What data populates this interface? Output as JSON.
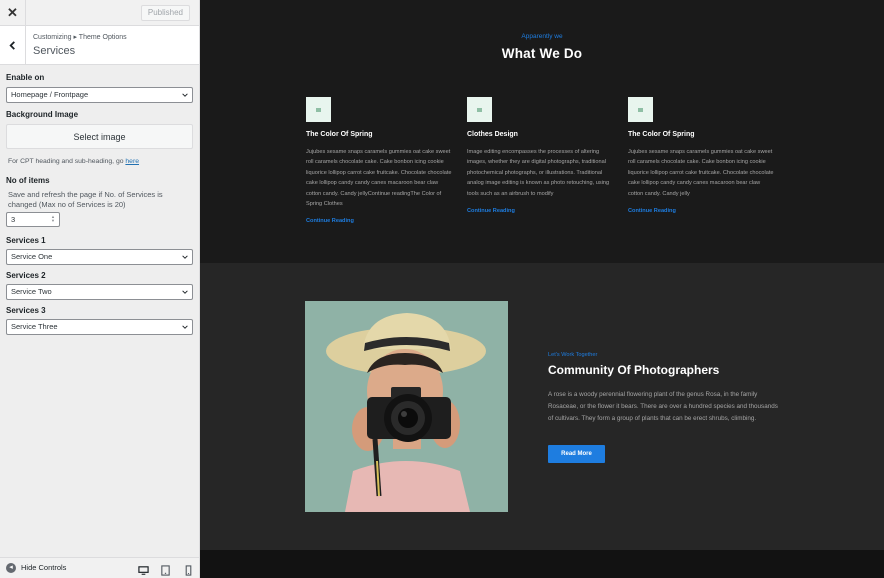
{
  "sidebar": {
    "close_icon": "close-icon",
    "publish_label": "Published",
    "breadcrumb": "Customizing ▸ Theme Options",
    "section_title": "Services",
    "enable_on": {
      "label": "Enable on",
      "value": "Homepage / Frontpage"
    },
    "background_image": {
      "label": "Background Image",
      "button": "Select image"
    },
    "cpt_note": {
      "text": "For CPT heading and sub-heading, go",
      "link": "here"
    },
    "no_of_items": {
      "label": "No of items",
      "description": "Save and refresh the page if No. of Services is changed (Max no of Services is 20)",
      "value": "3"
    },
    "services": [
      {
        "label": "Services 1",
        "value": "Service One"
      },
      {
        "label": "Services 2",
        "value": "Service Two"
      },
      {
        "label": "Services 3",
        "value": "Service Three"
      }
    ],
    "footer": {
      "hide_label": "Hide Controls",
      "devices": [
        "desktop-icon",
        "tablet-icon",
        "mobile-icon"
      ]
    }
  },
  "preview": {
    "services_section": {
      "subtitle": "Apparently we",
      "title": "What We Do",
      "cards": [
        {
          "title": "The Color Of Spring",
          "text": "Jujubes sesame snaps caramels gummies oat cake sweet roll caramels chocolate cake. Cake bonbon icing cookie liquorice lollipop carrot cake fruitcake. Chocolate chocolate cake lollipop candy candy canes macaroon bear claw cotton candy. Candy jellyContinue readingThe Color of Spring Clothes",
          "link": "Continue Reading"
        },
        {
          "title": "Clothes Design",
          "text": "Image editing encompasses the processes of altering images, whether they are digital photographs, traditional photochemical photographs, or illustrations. Traditional analog image editing is known as photo retouching, using tools such as an airbrush to modify",
          "link": "Continue Reading"
        },
        {
          "title": "The Color Of Spring",
          "text": "Jujubes sesame snaps caramels gummies oat cake sweet roll caramels chocolate cake. Cake bonbon icing cookie liquorice lollipop carrot cake fruitcake. Chocolate chocolate cake lollipop candy candy canes macaroon bear claw cotton candy. Candy jelly",
          "link": "Continue Reading"
        }
      ]
    },
    "community_section": {
      "eyebrow": "Let's Work Together",
      "title": "Community Of Photographers",
      "text": "A rose is a woody perennial flowering plant of the genus Rosa, in the family Rosaceae, or the flower it bears. There are over a hundred species and thousands of cultivars. They form a group of plants that can be erect shrubs, climbing.",
      "button": "Read More"
    }
  },
  "colors": {
    "accent": "#1e7de0",
    "dark_bg": "#1a1a1a",
    "panel_bg": "#262626",
    "sidebar_bg": "#eeeeee"
  }
}
